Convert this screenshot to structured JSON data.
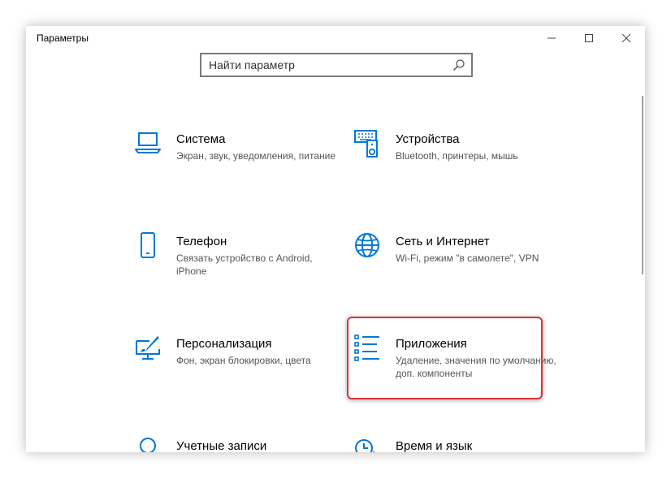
{
  "window": {
    "title": "Параметры",
    "controls": {
      "minimize": "minimize-icon",
      "maximize": "maximize-icon",
      "close": "close-icon"
    }
  },
  "search": {
    "placeholder": "Найти параметр",
    "icon": "search-icon"
  },
  "items": [
    {
      "name": "Система",
      "desc": "Экран, звук, уведомления, питание",
      "icon": "laptop-icon"
    },
    {
      "name": "Устройства",
      "desc": "Bluetooth, принтеры, мышь",
      "icon": "devices-icon"
    },
    {
      "name": "Телефон",
      "desc": "Связать устройство с Android, iPhone",
      "icon": "phone-icon"
    },
    {
      "name": "Сеть и Интернет",
      "desc": "Wi-Fi, режим \"в самолете\", VPN",
      "icon": "globe-icon"
    },
    {
      "name": "Персонализация",
      "desc": "Фон, экран блокировки, цвета",
      "icon": "personalization-icon"
    },
    {
      "name": "Приложения",
      "desc": "Удаление, значения по умолчанию, доп. компоненты",
      "icon": "apps-list-icon"
    },
    {
      "name": "Учетные записи",
      "desc": "",
      "icon": "account-icon"
    },
    {
      "name": "Время и язык",
      "desc": "",
      "icon": "time-language-icon"
    }
  ],
  "colors": {
    "accent": "#0078d7",
    "highlight": "#d9333d"
  }
}
